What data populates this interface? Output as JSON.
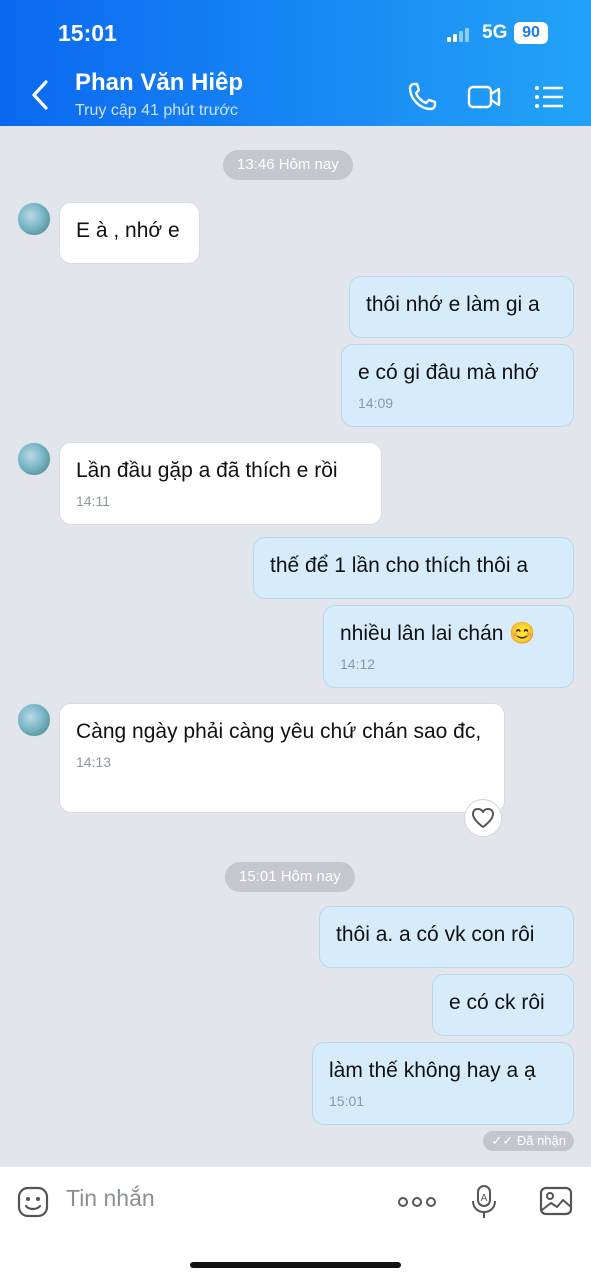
{
  "status_bar": {
    "time": "15:01",
    "network": "5G",
    "battery": "90"
  },
  "header": {
    "contact_name": "Phan Văn Hiêp",
    "contact_status": "Truy cập 41 phút trước",
    "icons": [
      "back-chevron-icon",
      "phone-icon",
      "video-call-icon",
      "menu-list-icon"
    ]
  },
  "chat": {
    "separators": [
      "13:46 Hôm nay",
      "15:01 Hôm nay"
    ],
    "messages": [
      {
        "side": "in",
        "text": "E à , nhớ e",
        "time": ""
      },
      {
        "side": "out",
        "text": "thôi nhớ e làm gi a",
        "time": ""
      },
      {
        "side": "out",
        "text": "e có gi đâu mà nhớ",
        "time": "14:09"
      },
      {
        "side": "in",
        "text": "Lần đầu gặp a đã thích e rồi",
        "time": "14:11"
      },
      {
        "side": "out",
        "text": "thế để 1 lần cho thích thôi a",
        "time": ""
      },
      {
        "side": "out",
        "text": "nhiều lân lai chán 😊",
        "time": "14:12"
      },
      {
        "side": "in",
        "text": "Càng ngày phải càng yêu chứ chán sao đc,",
        "time": "14:13"
      },
      {
        "side": "out",
        "text": "thôi a. a có vk con rôi",
        "time": ""
      },
      {
        "side": "out",
        "text": "e có ck rôi",
        "time": ""
      },
      {
        "side": "out",
        "text": "làm thế không hay a ạ",
        "time": "15:01"
      }
    ],
    "seen_label": "✓✓ Đã nhận"
  },
  "input_bar": {
    "placeholder": "Tin nhắn",
    "icons": [
      "emoji-sticker-icon",
      "more-options-icon",
      "voice-mic-icon",
      "image-gallery-icon"
    ]
  },
  "colors": {
    "header_start": "#0a68f0",
    "header_end": "#22a3f7",
    "out_bubble": "#d6ecfb",
    "in_bubble": "#ffffff",
    "chat_bg": "#e2e5ec"
  }
}
